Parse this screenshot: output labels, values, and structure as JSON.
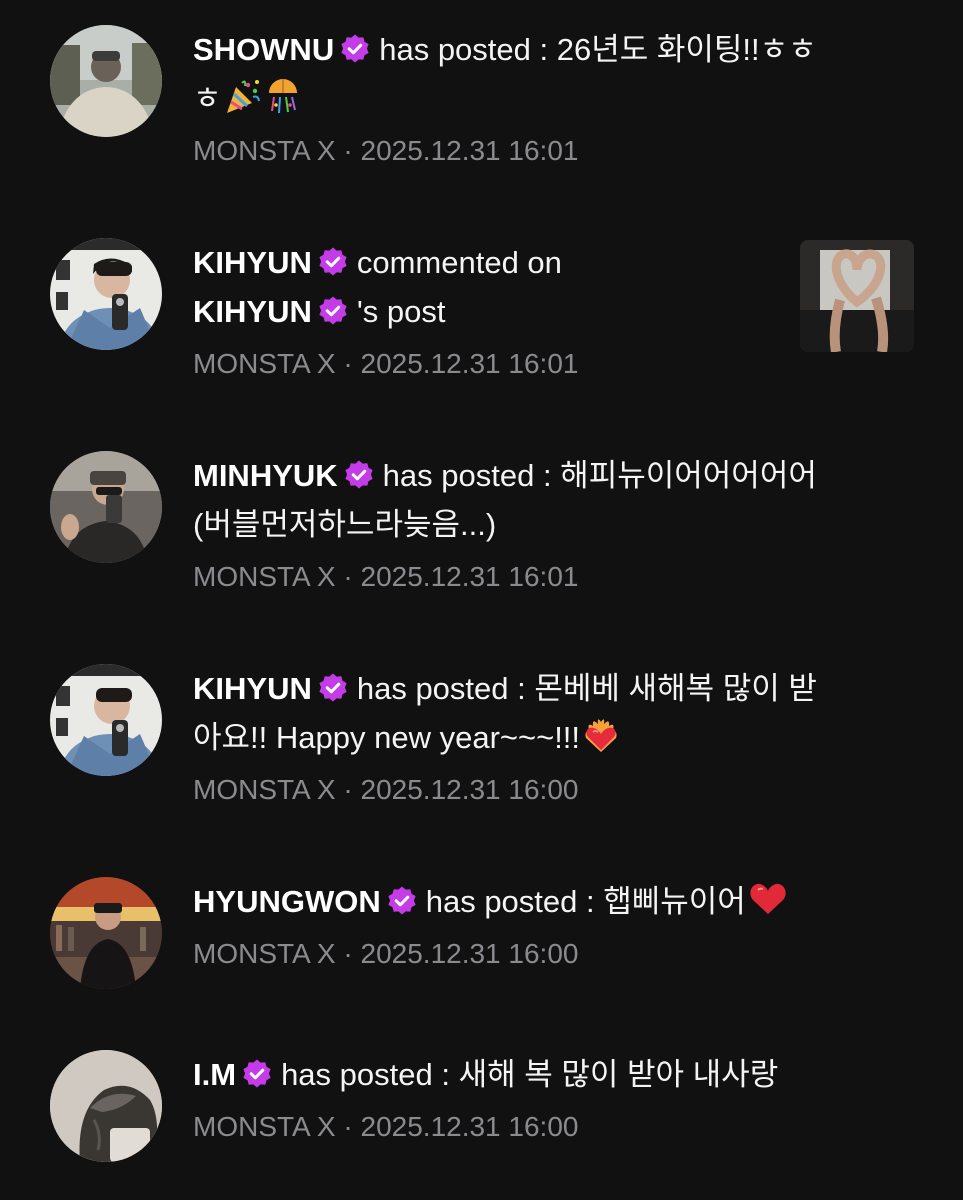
{
  "notifications": [
    {
      "name": "SHOWNU",
      "verified_icon": "verified-badge-icon",
      "action": "has posted : 26년도 화이팅!!ㅎㅎ",
      "action_cont": "ㅎ",
      "emoji": [
        "party-popper-icon",
        "confetti-ball-icon"
      ],
      "meta": "MONSTA X · 2025.12.31 16:01"
    },
    {
      "name": "KIHYUN",
      "verified_icon": "verified-badge-icon",
      "action": "commented on",
      "target_name": "KIHYUN",
      "target_suffix": "'s post",
      "meta": "MONSTA X · 2025.12.31 16:01",
      "thumbnail": "post-thumbnail"
    },
    {
      "name": "MINHYUK",
      "verified_icon": "verified-badge-icon",
      "action": "has posted : 해피뉴이어어어어어",
      "action_cont": "(버블먼저하느라늦음...)",
      "meta": "MONSTA X · 2025.12.31 16:01"
    },
    {
      "name": "KIHYUN",
      "verified_icon": "verified-badge-icon",
      "action": "has posted : 몬베베 새해복 많이 받",
      "action_cont": "아요!! Happy new year~~~!!!",
      "emoji": [
        "heart-on-fire-icon"
      ],
      "meta": "MONSTA X · 2025.12.31 16:00"
    },
    {
      "name": "HYUNGWON",
      "verified_icon": "verified-badge-icon",
      "action": "has posted : 햅삐뉴이어",
      "emoji": [
        "red-heart-icon"
      ],
      "meta": "MONSTA X · 2025.12.31 16:00"
    },
    {
      "name": "I.M",
      "verified_icon": "verified-badge-icon",
      "action": "has posted : 새해 복 많이 받아 내사랑",
      "meta": "MONSTA X · 2025.12.31 16:00"
    }
  ],
  "colors": {
    "background": "#111112",
    "badge": "#c43ce8",
    "meta_text": "#8b8b8f"
  }
}
